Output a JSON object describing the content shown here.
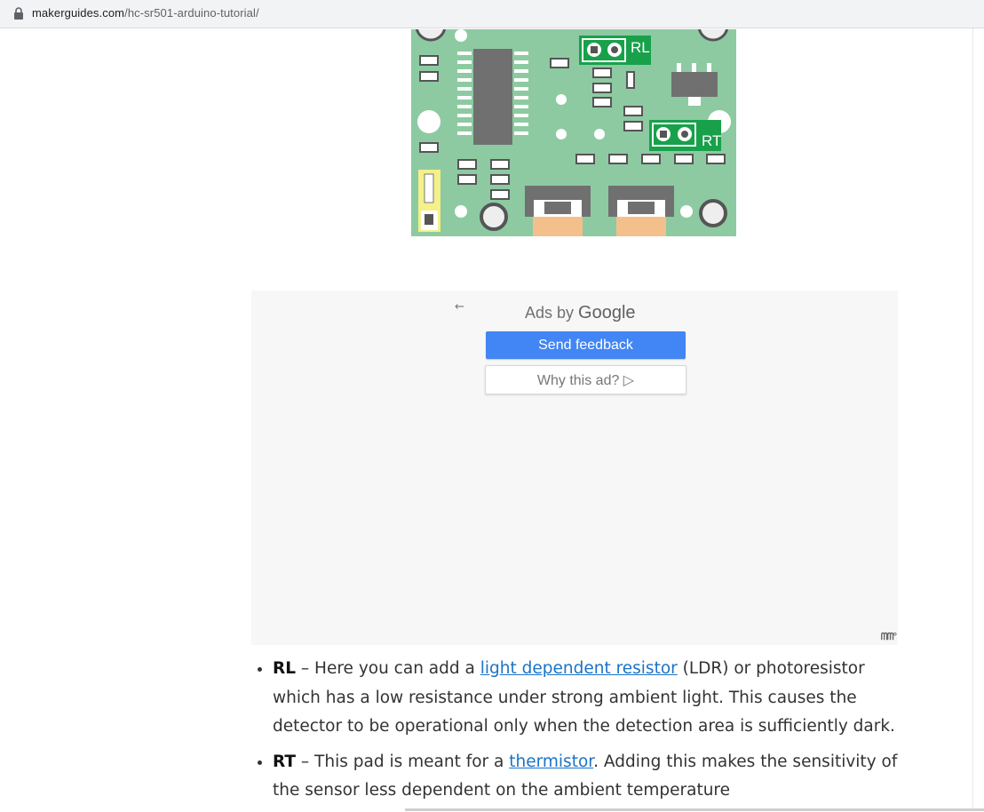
{
  "browser": {
    "domain": "makerguides.com",
    "path": "/hc-sr501-arduino-tutorial/"
  },
  "pcb": {
    "label_rl": "RL",
    "label_rt": "RT"
  },
  "ad": {
    "ads_by": "Ads by",
    "google": "Google",
    "send_feedback": "Send feedback",
    "why_this_ad": "Why this ad? ▷",
    "back_arrow": "←",
    "mark": "ᗰᗰ°"
  },
  "article": {
    "items": [
      {
        "term": "RL",
        "text_before": " – Here you can add a ",
        "link": "light dependent resistor",
        "text_after": " (LDR) or photoresistor which has a low resistance under strong ambient light. This causes the detector to be operational only when the detection area is sufficiently dark."
      },
      {
        "term": "RT",
        "text_before": " – This pad is meant for a ",
        "link": "thermistor",
        "text_after": ". Adding this makes the sensitivity of the sensor less dependent on the ambient temperature"
      }
    ]
  },
  "colors": {
    "accent_button": "#4285f4",
    "link": "#1a73c7",
    "pcb_green": "#8dcaa2",
    "pad_green": "#18a14a"
  }
}
